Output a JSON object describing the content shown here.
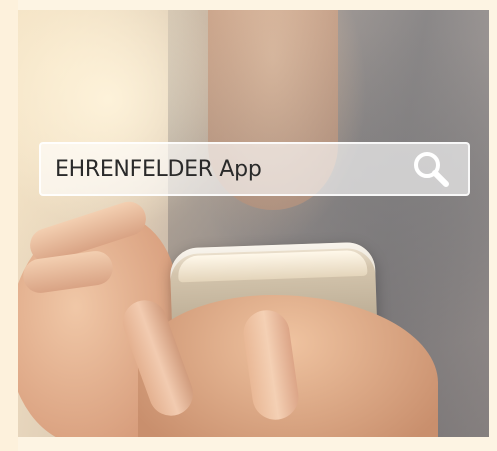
{
  "search": {
    "query": "EHRENFELDER App",
    "icon": "search-icon"
  },
  "colors": {
    "page_background": "#fdf4e3",
    "search_text": "#2a2a2a",
    "search_border": "#ffffff"
  }
}
